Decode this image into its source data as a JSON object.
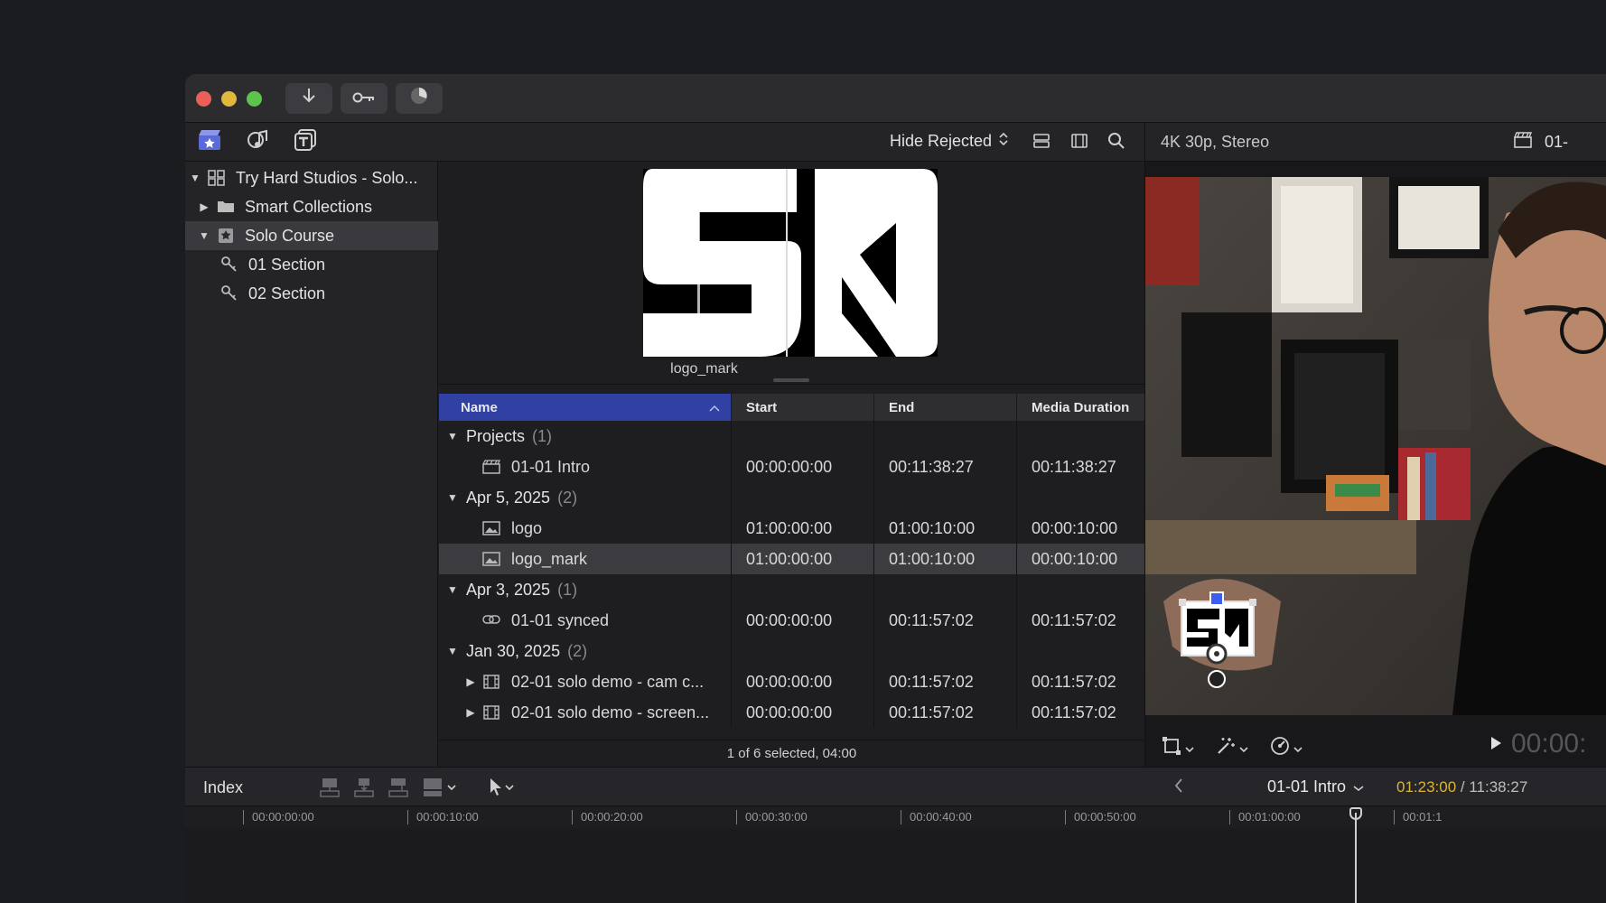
{
  "toolbar": {
    "import_icon": "download-arrow-icon",
    "keyword_icon": "key-icon",
    "background_tasks_icon": "progress-circle-icon"
  },
  "browser_toolbar": {
    "filter_label": "Hide Rejected"
  },
  "viewer": {
    "format_label": "4K 30p, Stereo",
    "project_short": "01-",
    "timecode_partial": "00:00:"
  },
  "sidebar": {
    "items": [
      {
        "label": "Try Hard Studios - Solo...",
        "expanded": true
      },
      {
        "label": "Smart Collections",
        "expanded": false
      },
      {
        "label": "Solo Course",
        "expanded": true
      },
      {
        "label": "01 Section"
      },
      {
        "label": "02 Section"
      }
    ]
  },
  "filmstrip": {
    "caption": "logo_mark"
  },
  "table": {
    "headers": {
      "name": "Name",
      "start": "Start",
      "end": "End",
      "duration": "Media Duration"
    },
    "rows": [
      {
        "kind": "group",
        "name": "Projects",
        "count": "(1)"
      },
      {
        "kind": "clip",
        "icon": "clapper-icon",
        "name": "01-01 Intro",
        "start": "00:00:00:00",
        "end": "00:11:38:27",
        "duration": "00:11:38:27"
      },
      {
        "kind": "group",
        "name": "Apr 5, 2025",
        "count": "(2)"
      },
      {
        "kind": "clip",
        "icon": "image-icon",
        "name": "logo",
        "start": "01:00:00:00",
        "end": "01:00:10:00",
        "duration": "00:00:10:00"
      },
      {
        "kind": "clip",
        "icon": "image-icon",
        "name": "logo_mark",
        "start": "01:00:00:00",
        "end": "01:00:10:00",
        "duration": "00:00:10:00",
        "selected": true
      },
      {
        "kind": "group",
        "name": "Apr 3, 2025",
        "count": "(1)"
      },
      {
        "kind": "clip",
        "icon": "synced-clip-icon",
        "name": "01-01 synced",
        "start": "00:00:00:00",
        "end": "00:11:57:02",
        "duration": "00:11:57:02"
      },
      {
        "kind": "group",
        "name": "Jan 30, 2025",
        "count": "(2)"
      },
      {
        "kind": "clip",
        "icon": "film-icon",
        "name": "02-01 solo demo - cam c...",
        "start": "00:00:00:00",
        "end": "00:11:57:02",
        "duration": "00:11:57:02",
        "expandable": true
      },
      {
        "kind": "clip",
        "icon": "film-icon",
        "name": "02-01 solo demo - screen...",
        "start": "00:00:00:00",
        "end": "00:11:57:02",
        "duration": "00:11:57:02",
        "expandable": true
      }
    ]
  },
  "status": {
    "selection": "1 of 6 selected, 04:00"
  },
  "timeline": {
    "index_label": "Index",
    "project_name": "01-01 Intro",
    "current_time": "01:23:00",
    "separator": " / ",
    "total_time": "11:38:27",
    "ruler": [
      "00:00:00:00",
      "00:00:10:00",
      "00:00:20:00",
      "00:00:30:00",
      "00:00:40:00",
      "00:00:50:00",
      "00:01:00:00",
      "00:01:1"
    ]
  },
  "colors": {
    "accent_blue": "#3140a3",
    "time_yellow": "#d9b533",
    "close": "#ec5f57",
    "minimize": "#e0b83a",
    "zoom": "#5cc34b"
  }
}
